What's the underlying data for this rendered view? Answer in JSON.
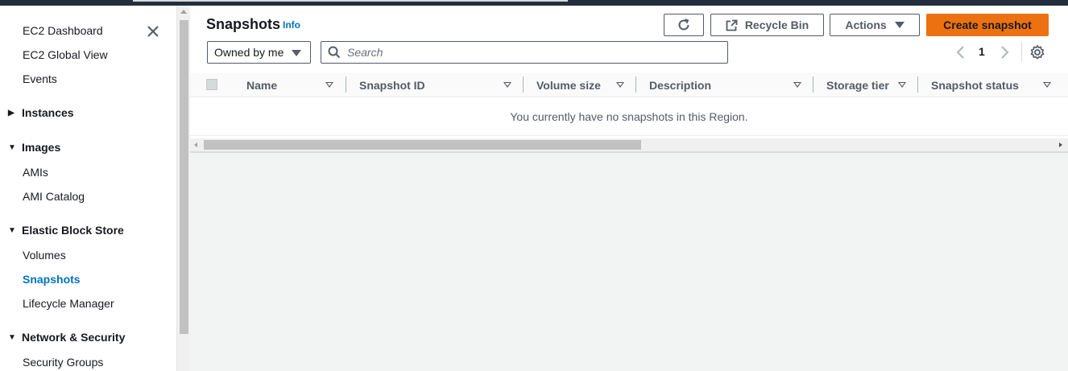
{
  "sidebar": {
    "items_top": [
      {
        "label": "EC2 Dashboard"
      },
      {
        "label": "EC2 Global View"
      },
      {
        "label": "Events"
      }
    ],
    "sections": [
      {
        "label": "Instances",
        "expanded": false,
        "items": []
      },
      {
        "label": "Images",
        "expanded": true,
        "items": [
          {
            "label": "AMIs"
          },
          {
            "label": "AMI Catalog"
          }
        ]
      },
      {
        "label": "Elastic Block Store",
        "expanded": true,
        "items": [
          {
            "label": "Volumes"
          },
          {
            "label": "Snapshots",
            "active": true
          },
          {
            "label": "Lifecycle Manager"
          }
        ]
      },
      {
        "label": "Network & Security",
        "expanded": true,
        "items": [
          {
            "label": "Security Groups"
          }
        ]
      }
    ],
    "close_icon": "close-icon"
  },
  "header": {
    "title": "Snapshots",
    "info_label": "Info",
    "refresh_icon": "refresh-icon",
    "recycle_label": "Recycle Bin",
    "actions_label": "Actions",
    "create_label": "Create snapshot"
  },
  "filters": {
    "owner_selected": "Owned by me",
    "search_placeholder": "Search"
  },
  "pagination": {
    "current_page": "1"
  },
  "table": {
    "columns": [
      "Name",
      "Snapshot ID",
      "Volume size",
      "Description",
      "Storage tier",
      "Snapshot status"
    ],
    "rows": [],
    "empty_message": "You currently have no snapshots in this Region."
  },
  "colors": {
    "accent": "#0073bb",
    "primary_button": "#ec7211",
    "topbar": "#232f3e"
  }
}
